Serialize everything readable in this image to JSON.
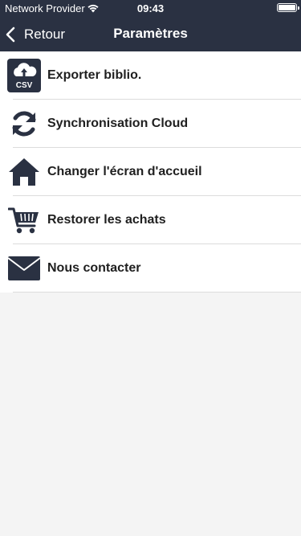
{
  "status_bar": {
    "carrier": "Network Provider",
    "time": "09:43"
  },
  "nav": {
    "back_label": "Retour",
    "title": "Paramètres"
  },
  "settings": {
    "items": [
      {
        "label": "Exporter biblio.",
        "icon": "csv-export-icon",
        "icon_text": "CSV"
      },
      {
        "label": "Synchronisation Cloud",
        "icon": "sync-icon"
      },
      {
        "label": "Changer l'écran d'accueil",
        "icon": "home-icon"
      },
      {
        "label": "Restorer les achats",
        "icon": "cart-icon"
      },
      {
        "label": "Nous contacter",
        "icon": "envelope-icon"
      }
    ]
  },
  "colors": {
    "navbar": "#2a3142",
    "icon": "#2a3142",
    "background": "#f4f4f4"
  }
}
